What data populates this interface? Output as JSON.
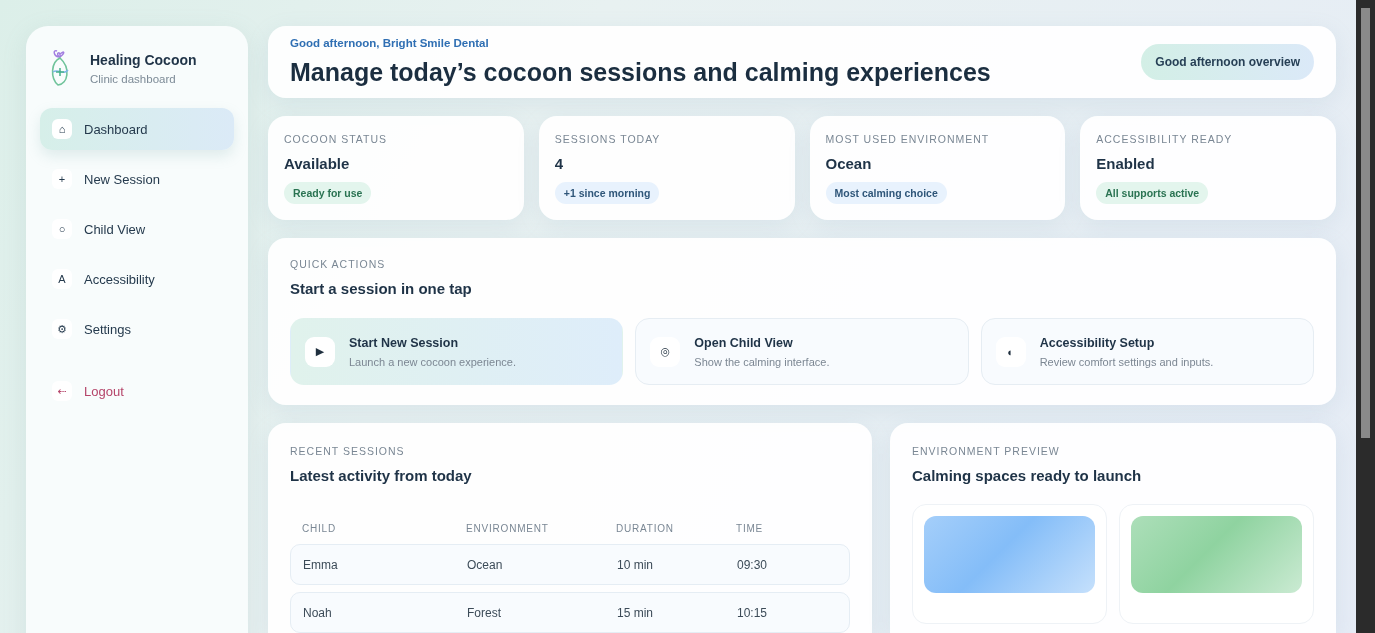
{
  "brand": {
    "title": "Healing Cocoon",
    "subtitle": "Clinic dashboard"
  },
  "sidebar": {
    "items": [
      {
        "icon": "⌂",
        "label": "Dashboard",
        "selected": true,
        "kind": "nav"
      },
      {
        "icon": "+",
        "label": "New Session",
        "selected": false,
        "kind": "nav"
      },
      {
        "icon": "○",
        "label": "Child View",
        "selected": false,
        "kind": "nav"
      },
      {
        "icon": "A",
        "label": "Accessibility",
        "selected": false,
        "kind": "nav"
      },
      {
        "icon": "⚙",
        "label": "Settings",
        "selected": false,
        "kind": "nav"
      },
      {
        "icon": "⇠",
        "label": "Logout",
        "selected": false,
        "kind": "danger"
      }
    ]
  },
  "header": {
    "greeting": "Good afternoon, Bright Smile Dental",
    "title": "Manage today’s cocoon sessions and calming experiences",
    "button": "Good afternoon overview"
  },
  "stats": [
    {
      "label": "COCOON STATUS",
      "value": "Available",
      "badge": "Ready for use",
      "kind": "green"
    },
    {
      "label": "SESSIONS TODAY",
      "value": "4",
      "badge": "+1 since morning",
      "kind": "blue"
    },
    {
      "label": "MOST USED ENVIRONMENT",
      "value": "Ocean",
      "badge": "Most calming choice",
      "kind": "blue"
    },
    {
      "label": "ACCESSIBILITY READY",
      "value": "Enabled",
      "badge": "All supports active",
      "kind": "green"
    }
  ],
  "quick_actions": {
    "eyebrow": "QUICK ACTIONS",
    "title": "Start a session in one tap",
    "actions": [
      {
        "icon": "▶",
        "title": "Start New Session",
        "description": "Launch a new cocoon experience.",
        "selected": true
      },
      {
        "icon": "◎",
        "title": "Open Child View",
        "description": "Show the calming interface.",
        "selected": false
      },
      {
        "icon": "◐",
        "title": "Accessibility Setup",
        "description": "Review comfort settings and inputs.",
        "selected": false
      }
    ]
  },
  "recent_sessions": {
    "eyebrow": "RECENT SESSIONS",
    "title": "Latest activity from today",
    "columns": [
      "CHILD",
      "ENVIRONMENT",
      "DURATION",
      "TIME"
    ],
    "rows": [
      [
        "Emma",
        "Ocean",
        "10 min",
        "09:30"
      ],
      [
        "Noah",
        "Forest",
        "15 min",
        "10:15"
      ]
    ]
  },
  "environment_preview": {
    "eyebrow": "ENVIRONMENT PREVIEW",
    "title": "Calming spaces ready to launch",
    "environments": [
      {
        "color": "#84bdf8"
      },
      {
        "color": "#8fd3a0"
      }
    ]
  }
}
